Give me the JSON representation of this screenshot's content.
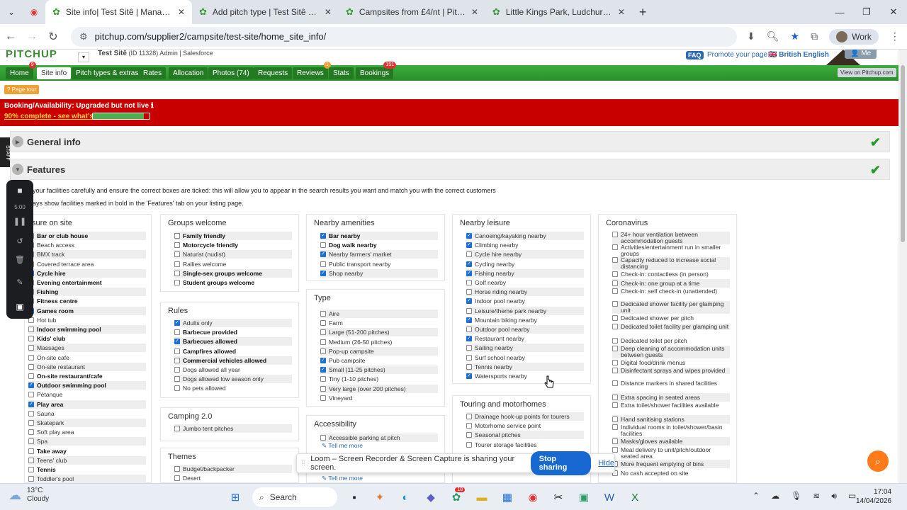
{
  "browser": {
    "tabs": [
      {
        "title": "Site info| Test Sitê | Manager pa",
        "active": true
      },
      {
        "title": "Add pitch type | Test Sitê | Man",
        "active": false
      },
      {
        "title": "Campsites from £4/nt | Pitchup",
        "active": false
      },
      {
        "title": "Little Kings Park, Ludchurch, Pe",
        "active": false
      }
    ],
    "url": "pitchup.com/supplier2/campsite/test-site/home_site_info/",
    "profile": "Work"
  },
  "header": {
    "logo": "PITCHUP",
    "site_name": "Test Sitê",
    "site_meta": "(ID 11328)  Admin | Salesforce",
    "faq": "FAQ",
    "promote": "Promote your page",
    "language": "British English",
    "me": "Me",
    "view_on_pitchup": "View on Pitchup.com",
    "page_tour": "Page tour"
  },
  "nav": [
    {
      "label": "Home",
      "badge": "9"
    },
    {
      "label": "Site info",
      "badge": ""
    },
    {
      "label": "Pitch types & extras",
      "badge": ""
    },
    {
      "label": "Rates",
      "badge": ""
    },
    {
      "label": "Allocation",
      "badge": ""
    },
    {
      "label": "Photos (74)",
      "badge": ""
    },
    {
      "label": "Requests",
      "badge": ""
    },
    {
      "label": "Reviews",
      "badge": "1"
    },
    {
      "label": "Stats",
      "badge": ""
    },
    {
      "label": "Bookings",
      "badge": "151"
    }
  ],
  "status": {
    "line1": "Booking/Availability: Upgraded but not live ℹ",
    "line2": "90% complete - see what's left",
    "progress": 0.9
  },
  "sections": {
    "general": "General info",
    "features": "Features",
    "staff": "STAFF"
  },
  "intro": {
    "line1": "your facilities carefully and ensure the correct boxes are ticked: this will allow you to appear in the search results you want and match you with the correct customers",
    "line2": "ays show facilities marked in bold in the 'Features' tab on your listing page."
  },
  "loom_side": {
    "time": "5:00"
  },
  "on_site": {
    "title": "sure on site",
    "items": [
      {
        "l": "Bar or club house",
        "c": false,
        "b": true
      },
      {
        "l": "Beach access",
        "c": false,
        "b": false
      },
      {
        "l": "BMX track",
        "c": false,
        "b": false
      },
      {
        "l": "Covered terrace area",
        "c": false,
        "b": false
      },
      {
        "l": "Cycle hire",
        "c": true,
        "b": true
      },
      {
        "l": "Evening entertainment",
        "c": false,
        "b": true
      },
      {
        "l": "Fishing",
        "c": false,
        "b": true
      },
      {
        "l": "Fitness centre",
        "c": false,
        "b": true
      },
      {
        "l": "Games room",
        "c": true,
        "b": true
      },
      {
        "l": "Hot tub",
        "c": false,
        "b": false
      },
      {
        "l": "Indoor swimming pool",
        "c": false,
        "b": true
      },
      {
        "l": "Kids' club",
        "c": false,
        "b": true
      },
      {
        "l": "Massages",
        "c": false,
        "b": false
      },
      {
        "l": "On-site cafe",
        "c": false,
        "b": false
      },
      {
        "l": "On-site restaurant",
        "c": false,
        "b": false
      },
      {
        "l": "On-site restaurant/cafe",
        "c": false,
        "b": true
      },
      {
        "l": "Outdoor swimming pool",
        "c": true,
        "b": true
      },
      {
        "l": "Pétanque",
        "c": false,
        "b": false
      },
      {
        "l": "Play area",
        "c": true,
        "b": true
      },
      {
        "l": "Sauna",
        "c": false,
        "b": false
      },
      {
        "l": "Skatepark",
        "c": false,
        "b": false
      },
      {
        "l": "Soft play area",
        "c": false,
        "b": false
      },
      {
        "l": "Spa",
        "c": false,
        "b": false
      },
      {
        "l": "Take away",
        "c": false,
        "b": true
      },
      {
        "l": "Teens' club",
        "c": false,
        "b": false
      },
      {
        "l": "Tennis",
        "c": false,
        "b": true
      },
      {
        "l": "Toddler's pool",
        "c": false,
        "b": false
      }
    ]
  },
  "groups": {
    "title": "Groups welcome",
    "items": [
      {
        "l": "Family friendly",
        "c": false,
        "b": true
      },
      {
        "l": "Motorcycle friendly",
        "c": false,
        "b": true
      },
      {
        "l": "Naturist (nudist)",
        "c": false,
        "b": false
      },
      {
        "l": "Rallies welcome",
        "c": false,
        "b": false
      },
      {
        "l": "Single-sex groups welcome",
        "c": false,
        "b": true
      },
      {
        "l": "Student groups welcome",
        "c": false,
        "b": true
      }
    ]
  },
  "rules": {
    "title": "Rules",
    "items": [
      {
        "l": "Adults only",
        "c": true,
        "b": false
      },
      {
        "l": "Barbecue provided",
        "c": false,
        "b": true
      },
      {
        "l": "Barbecues allowed",
        "c": true,
        "b": true
      },
      {
        "l": "Campfires allowed",
        "c": false,
        "b": true
      },
      {
        "l": "Commercial vehicles allowed",
        "c": false,
        "b": true
      },
      {
        "l": "Dogs allowed all year",
        "c": false,
        "b": false
      },
      {
        "l": "Dogs allowed low season only",
        "c": false,
        "b": false
      },
      {
        "l": "No pets allowed",
        "c": false,
        "b": false
      }
    ]
  },
  "camping2": {
    "title": "Camping 2.0",
    "items": [
      {
        "l": "Jumbo tent pitches",
        "c": false,
        "b": false
      }
    ]
  },
  "themes": {
    "title": "Themes",
    "items": [
      {
        "l": "Budget/backpacker",
        "c": false,
        "b": false
      },
      {
        "l": "Desert",
        "c": false,
        "b": false
      }
    ]
  },
  "amenities": {
    "title": "Nearby amenities",
    "items": [
      {
        "l": "Bar nearby",
        "c": true,
        "b": true
      },
      {
        "l": "Dog walk nearby",
        "c": false,
        "b": true
      },
      {
        "l": "Nearby farmers' market",
        "c": true,
        "b": false
      },
      {
        "l": "Public transport nearby",
        "c": false,
        "b": false
      },
      {
        "l": "Shop nearby",
        "c": true,
        "b": false
      }
    ]
  },
  "type": {
    "title": "Type",
    "items": [
      {
        "l": "Aire",
        "c": false,
        "b": false
      },
      {
        "l": "Farm",
        "c": false,
        "b": false
      },
      {
        "l": "Large (51-200 pitches)",
        "c": false,
        "b": false
      },
      {
        "l": "Medium (26-50 pitches)",
        "c": false,
        "b": false
      },
      {
        "l": "Pop-up campsite",
        "c": false,
        "b": false
      },
      {
        "l": "Pub campsite",
        "c": true,
        "b": false
      },
      {
        "l": "Small (11-25 pitches)",
        "c": true,
        "b": false
      },
      {
        "l": "Tiny (1-10 pitches)",
        "c": false,
        "b": false
      },
      {
        "l": "Very large (over 200 pitches)",
        "c": false,
        "b": false
      },
      {
        "l": "Vineyard",
        "c": false,
        "b": false
      }
    ]
  },
  "accessibility": {
    "title": "Accessibility",
    "items": [
      {
        "l": "Accessible parking at pitch",
        "c": false,
        "b": false
      }
    ],
    "tell_more": "Tell me more",
    "tell_more2": "Tell me more"
  },
  "leisure": {
    "title": "Nearby leisure",
    "items": [
      {
        "l": "Canoeing/kayaking nearby",
        "c": true,
        "b": false
      },
      {
        "l": "Climbing nearby",
        "c": true,
        "b": false
      },
      {
        "l": "Cycle hire nearby",
        "c": false,
        "b": false
      },
      {
        "l": "Cycling nearby",
        "c": true,
        "b": false
      },
      {
        "l": "Fishing nearby",
        "c": true,
        "b": false
      },
      {
        "l": "Golf nearby",
        "c": false,
        "b": false
      },
      {
        "l": "Horse riding nearby",
        "c": false,
        "b": false
      },
      {
        "l": "Indoor pool nearby",
        "c": true,
        "b": false
      },
      {
        "l": "Leisure/theme park nearby",
        "c": false,
        "b": false
      },
      {
        "l": "Mountain biking nearby",
        "c": true,
        "b": false
      },
      {
        "l": "Outdoor pool nearby",
        "c": false,
        "b": false
      },
      {
        "l": "Restaurant nearby",
        "c": true,
        "b": false
      },
      {
        "l": "Sailing nearby",
        "c": false,
        "b": false
      },
      {
        "l": "Surf school nearby",
        "c": false,
        "b": false
      },
      {
        "l": "Tennis nearby",
        "c": false,
        "b": false
      },
      {
        "l": "Watersports nearby",
        "c": true,
        "b": false
      }
    ]
  },
  "touring": {
    "title": "Touring and motorhomes",
    "items": [
      {
        "l": "Drainage hook-up points for tourers",
        "c": false,
        "b": false
      },
      {
        "l": "Motorhome service point",
        "c": false,
        "b": false
      },
      {
        "l": "Seasonal pitches",
        "c": false,
        "b": false
      },
      {
        "l": "Tourer storage facilities",
        "c": false,
        "b": false
      }
    ]
  },
  "corona": {
    "title": "Coronavirus",
    "items": [
      {
        "l": "24+ hour ventilation between accommodation guests",
        "c": false,
        "b": false
      },
      {
        "l": "Activities/entertainment run in smaller groups",
        "c": false,
        "b": false
      },
      {
        "l": "Capacity reduced to increase social distancing",
        "c": false,
        "b": false
      },
      {
        "l": "Check-in: contactless (in person)",
        "c": false,
        "b": false
      },
      {
        "l": "Check-in: one group at a time",
        "c": false,
        "b": false
      },
      {
        "l": "Check-in: self check-in (unattended)",
        "c": false,
        "b": false
      },
      {
        "l": "Dedicated shower facility per glamping unit",
        "c": false,
        "b": false
      },
      {
        "l": "Dedicated shower per pitch",
        "c": false,
        "b": false
      },
      {
        "l": "Dedicated toilet facility per glamping unit",
        "c": false,
        "b": false
      },
      {
        "l": "Dedicated toilet per pitch",
        "c": false,
        "b": false
      },
      {
        "l": "Deep cleaning of accommodation units between guests",
        "c": false,
        "b": false
      },
      {
        "l": "Digital food/drink menus",
        "c": false,
        "b": false
      },
      {
        "l": "Disinfectant sprays and wipes provided",
        "c": false,
        "b": false
      },
      {
        "l": "Distance markers in shared facilities",
        "c": false,
        "b": false
      },
      {
        "l": "Extra spacing in seated areas",
        "c": false,
        "b": false
      },
      {
        "l": "Extra toilet/shower facilities available",
        "c": false,
        "b": false
      },
      {
        "l": "Hand sanitising stations",
        "c": false,
        "b": false
      },
      {
        "l": "Individual rooms in toilet/shower/basin facilities",
        "c": false,
        "b": false
      },
      {
        "l": "Masks/gloves available",
        "c": false,
        "b": false
      },
      {
        "l": "Meal delivery to unit/pitch/outdoor seated area",
        "c": false,
        "b": false
      },
      {
        "l": "More frequent emptying of bins",
        "c": false,
        "b": false
      },
      {
        "l": "No cash accepted on site",
        "c": false,
        "b": false
      }
    ]
  },
  "loom": {
    "message": "Loom – Screen Recorder & Screen Capture is sharing your screen.",
    "stop": "Stop sharing",
    "hide": "Hide"
  },
  "taskbar": {
    "temp": "13°C",
    "weather": "Cloudy",
    "search": "Search",
    "time": "17:04",
    "date": "14/04/2026",
    "badge": "18"
  }
}
